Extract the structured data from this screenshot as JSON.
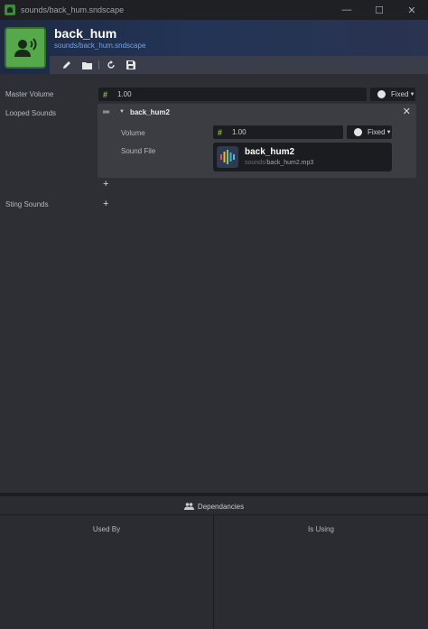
{
  "window": {
    "title": "sounds/back_hum.sndscape",
    "minimize": "—",
    "maximize": "☐",
    "close": "✕"
  },
  "asset": {
    "name": "back_hum",
    "path": "sounds/back_hum.sndscape",
    "thumbnail_icon": "voice-person-icon",
    "thumbnail_color": "#55a94a"
  },
  "toolbar": {
    "icons": [
      "pencil-icon",
      "folder-icon",
      "refresh-icon",
      "save-icon"
    ]
  },
  "master_volume": {
    "label": "Master Volume",
    "value": "1.00",
    "mode": "Fixed"
  },
  "looped_sounds": {
    "label": "Looped Sounds",
    "items": [
      {
        "name": "back_hum2",
        "volume_label": "Volume",
        "volume_value": "1.00",
        "volume_mode": "Fixed",
        "sound_file_label": "Sound File",
        "file_name": "back_hum2",
        "file_dir": "sounds/",
        "file_basename": "back_hum2.mp3"
      }
    ],
    "add": "+"
  },
  "sting_sounds": {
    "label": "Sting Sounds",
    "add": "+"
  },
  "dependencies": {
    "title": "Dependancies",
    "used_by": "Used By",
    "is_using": "Is Using"
  },
  "colors": {
    "accent_green": "#8bc34a",
    "link_blue": "#6fa3e8",
    "header_gradient": "#233456"
  }
}
